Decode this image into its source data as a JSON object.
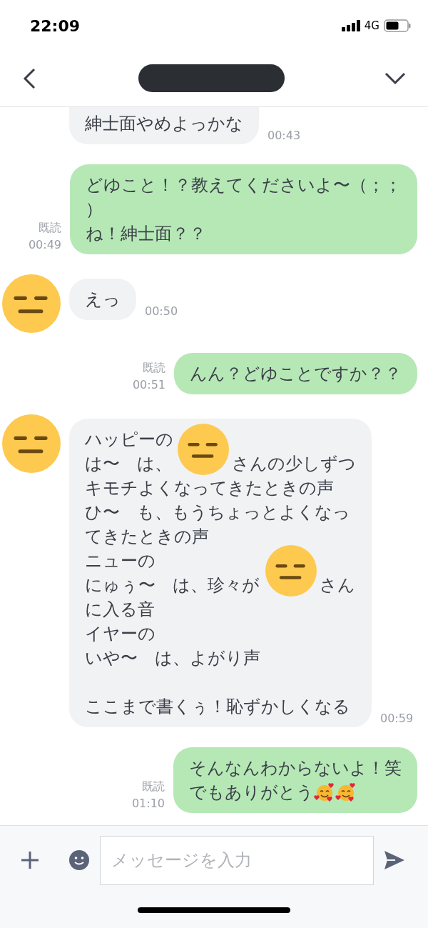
{
  "status_bar": {
    "time": "22:09",
    "network": "4G"
  },
  "messages": [
    {
      "kind": "received",
      "avatar": false,
      "cut_top": true,
      "time": "00:43",
      "paragraphs": [
        [
          [
            {
              "kind": "text",
              "text": "紳士面やめよっかな"
            }
          ]
        ]
      ]
    },
    {
      "kind": "sent",
      "cut_top": false,
      "read": "既読",
      "time": "00:49",
      "paragraphs": [
        [
          [
            {
              "kind": "text",
              "text": "どゆこと！？教えてくださいよ〜（；；"
            }
          ],
          [
            {
              "kind": "text",
              "text": "）"
            }
          ],
          [
            {
              "kind": "text",
              "text": "ね！紳士面？？"
            }
          ]
        ]
      ]
    },
    {
      "kind": "received",
      "avatar": true,
      "cut_top": false,
      "time": "00:50",
      "paragraphs": [
        [
          [
            {
              "kind": "text",
              "text": "えっ"
            }
          ]
        ]
      ]
    },
    {
      "kind": "sent",
      "cut_top": false,
      "read": "既読",
      "time": "00:51",
      "paragraphs": [
        [
          [
            {
              "kind": "text",
              "text": "んん？どゆことですか？？"
            }
          ]
        ]
      ]
    },
    {
      "kind": "received",
      "avatar": true,
      "cut_top": false,
      "time": "00:59",
      "paragraphs": [
        [
          [
            {
              "kind": "text",
              "text": "ハッピーの"
            }
          ],
          [
            {
              "kind": "text",
              "text": "は〜　は、"
            },
            {
              "kind": "sticker"
            },
            {
              "kind": "text",
              "text": "さんの少しずつ"
            }
          ],
          [
            {
              "kind": "text",
              "text": "キモチよくなってきたときの声"
            }
          ],
          [
            {
              "kind": "text",
              "text": "ひ〜　も、もうちょっとよくなっ"
            }
          ],
          [
            {
              "kind": "text",
              "text": "てきたときの声"
            }
          ],
          [
            {
              "kind": "text",
              "text": "ニューの"
            }
          ],
          [
            {
              "kind": "text",
              "text": "にゅぅ〜　は、珍々が"
            },
            {
              "kind": "sticker"
            },
            {
              "kind": "text",
              "text": "さん"
            }
          ],
          [
            {
              "kind": "text",
              "text": "に入る音"
            }
          ],
          [
            {
              "kind": "text",
              "text": "イヤーの"
            }
          ],
          [
            {
              "kind": "text",
              "text": "いや〜　は、よがり声"
            }
          ]
        ],
        [
          [
            {
              "kind": "text",
              "text": "ここまで書くぅ！恥ずかしくなる"
            }
          ]
        ]
      ]
    },
    {
      "kind": "sent",
      "cut_top": false,
      "read": "既読",
      "time": "01:10",
      "paragraphs": [
        [
          [
            {
              "kind": "text",
              "text": "そんなんわからないよ！笑"
            }
          ],
          [
            {
              "kind": "text",
              "text": "でもありがとう"
            },
            {
              "kind": "emoji"
            },
            {
              "kind": "emoji"
            }
          ]
        ]
      ]
    }
  ],
  "composer": {
    "placeholder": "メッセージを入力"
  }
}
